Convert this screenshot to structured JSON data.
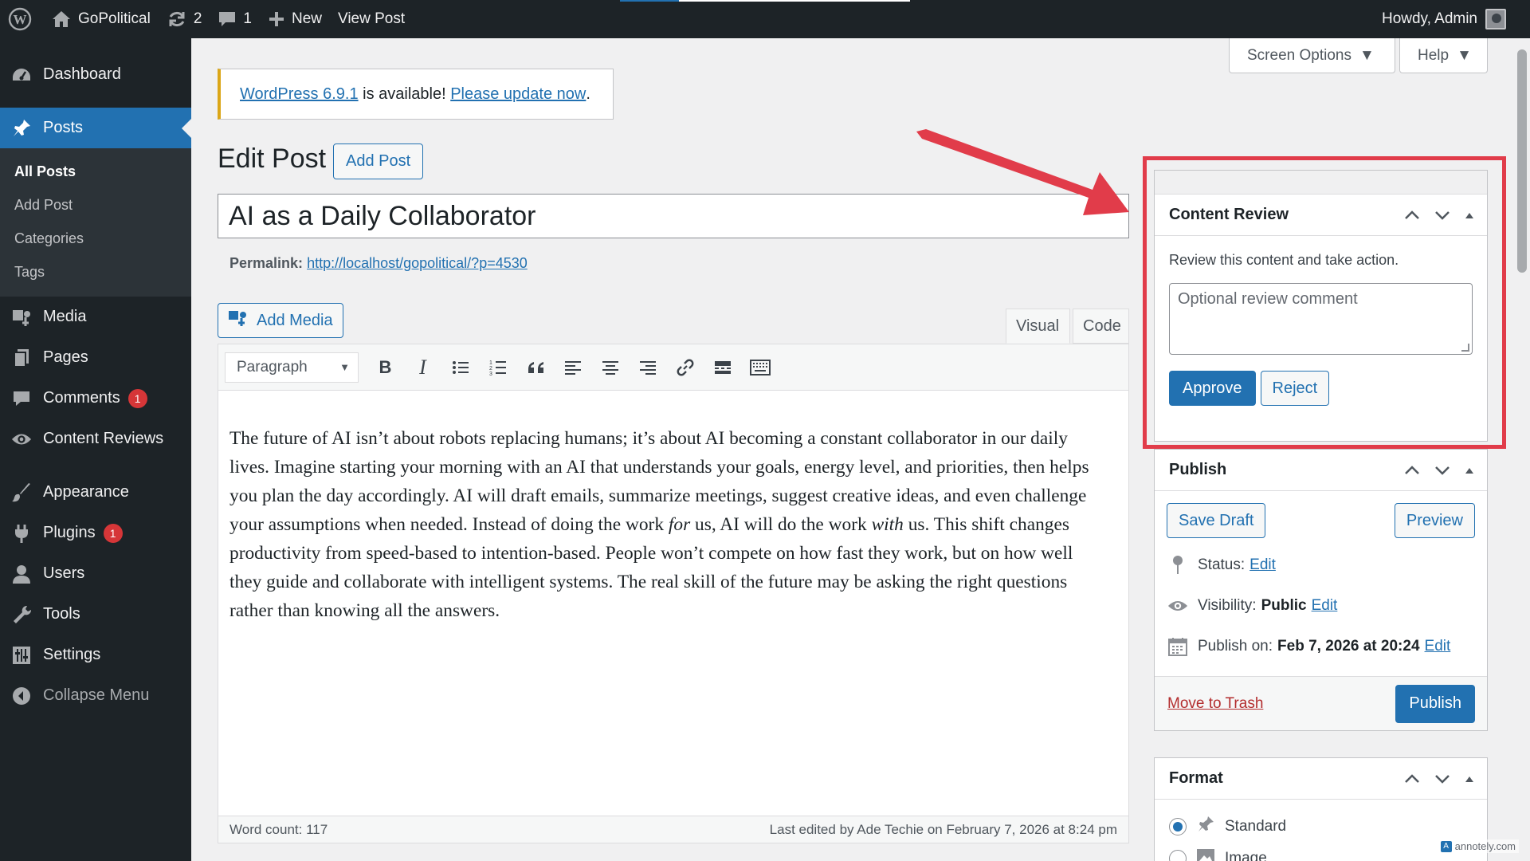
{
  "adminbar": {
    "site_name": "GoPolitical",
    "updates_count": "2",
    "comments_count": "1",
    "new_label": "New",
    "view_post_label": "View Post",
    "howdy": "Howdy, Admin"
  },
  "sidebar": {
    "dashboard": "Dashboard",
    "posts": "Posts",
    "submenu": [
      "All Posts",
      "Add Post",
      "Categories",
      "Tags"
    ],
    "media": "Media",
    "pages": "Pages",
    "comments": "Comments",
    "comments_badge": "1",
    "content_reviews": "Content Reviews",
    "appearance": "Appearance",
    "plugins": "Plugins",
    "plugins_badge": "1",
    "users": "Users",
    "tools": "Tools",
    "settings": "Settings",
    "collapse": "Collapse Menu"
  },
  "screen_options": "Screen Options",
  "help": "Help",
  "notice": {
    "version_link": "WordPress 6.9.1",
    "middle": " is available! ",
    "update_link": "Please update now",
    "end": "."
  },
  "page": {
    "title": "Edit Post",
    "add_post": "Add Post",
    "post_title": "AI as a Daily Collaborator",
    "permalink_label": "Permalink:",
    "permalink_url": "http://localhost/gopolitical/?p=4530"
  },
  "editor": {
    "add_media": "Add Media",
    "tab_visual": "Visual",
    "tab_code": "Code",
    "format": "Paragraph",
    "content_part1": "The future of AI isn’t about robots replacing humans; it’s about AI becoming a constant collaborator in our daily lives. Imagine starting your morning with an AI that understands your goals, energy level, and priorities, then helps you plan the day accordingly. AI will draft emails, summarize meetings, suggest creative ideas, and even challenge your assumptions when needed. Instead of doing the work ",
    "content_em1": "for",
    "content_part2": " us, AI will do the work ",
    "content_em2": "with",
    "content_part3": " us. This shift changes productivity from speed-based to intention-based. People won’t compete on how fast they work, but on how well they guide and collaborate with intelligent systems. The real skill of the future may be asking the right questions rather than knowing all the answers.",
    "word_count": "Word count: 117",
    "last_edited": "Last edited by Ade Techie on February 7, 2026 at 8:24 pm"
  },
  "review": {
    "title": "Content Review",
    "description": "Review this content and take action.",
    "comment_placeholder": "Optional review comment",
    "approve": "Approve",
    "reject": "Reject"
  },
  "publish": {
    "title": "Publish",
    "save_draft": "Save Draft",
    "preview": "Preview",
    "status_label": "Status:",
    "status_edit": "Edit",
    "visibility_label": "Visibility:",
    "visibility_value": "Public",
    "visibility_edit": "Edit",
    "publish_on_label": "Publish on:",
    "publish_on_value": "Feb 7, 2026 at 20:24",
    "publish_on_edit": "Edit",
    "trash": "Move to Trash",
    "publish_button": "Publish"
  },
  "format_box": {
    "title": "Format",
    "options": [
      "Standard",
      "Image"
    ],
    "selected": "Standard"
  },
  "watermark": "annotely.com",
  "colors": {
    "adminbar_bg": "#1d2327",
    "accent": "#2271b1",
    "highlight_red": "#e13c4a",
    "notice_warning": "#dba617"
  }
}
